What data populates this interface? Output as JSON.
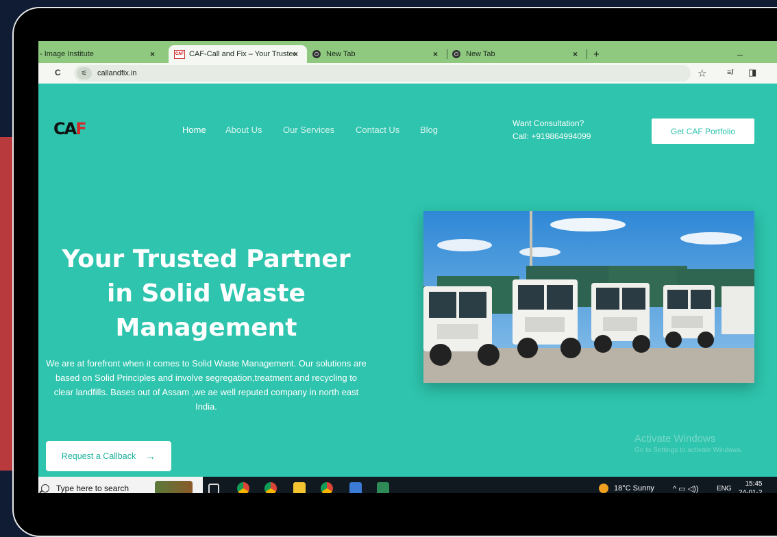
{
  "browser": {
    "tabs": [
      {
        "title": "- Image Institute",
        "close": "×"
      },
      {
        "title": "CAF-Call and Fix – Your Trusted",
        "close": "×",
        "favicon_text": "CAF"
      },
      {
        "title": "New Tab",
        "close": "×"
      },
      {
        "title": "New Tab",
        "close": "×"
      }
    ],
    "new_tab": "+",
    "minimize": "–",
    "url": "callandfix.in",
    "site_info_icon": "⚟",
    "reload_icon": "C",
    "star_icon": "☆",
    "extensions_icon": "≡/",
    "sidepanel_icon": "◨"
  },
  "site": {
    "logo_main": "CA",
    "logo_accent": "F",
    "nav": [
      "Home",
      "About Us",
      "Our Services",
      "Contact Us",
      "Blog"
    ],
    "consult_line1": "Want Consultation?",
    "consult_line2": "Call: +919864994099",
    "portfolio_button": "Get CAF Portfolio",
    "hero_title": "Your Trusted Partner in Solid Waste Management",
    "hero_description": "We are at forefront when it comes to Solid Waste Management. Our solutions are based on Solid Principles and involve segregation,treatment and recycling to clear landfills. Bases out of Assam ,we ae well reputed company in north east India.",
    "callback_button": "Request a Callback",
    "callback_arrow": "→",
    "watermark_line1": "Activate Windows",
    "watermark_line2": "Go to Settings to activate Windows."
  },
  "taskbar": {
    "search_placeholder": "Type here to search",
    "weather": "18°C  Sunny",
    "tray_icons": "^  ▭  ◁))",
    "language": "ENG",
    "time": "15:45",
    "date": "24-01-2"
  },
  "colors": {
    "site_bg": "#2ec4ad",
    "tab_bar": "#8fc97f",
    "red_accent": "#d32b2b",
    "frame_bg": "#101c33"
  }
}
